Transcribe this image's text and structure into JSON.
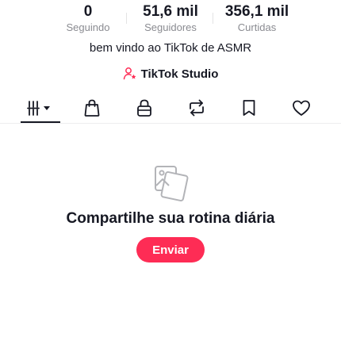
{
  "stats": {
    "following": {
      "value": "0",
      "label": "Seguindo"
    },
    "followers": {
      "value": "51,6 mil",
      "label": "Seguidores"
    },
    "likes": {
      "value": "356,1 mil",
      "label": "Curtidas"
    }
  },
  "bio": "bem vindo ao TikTok de ASMR",
  "studio": {
    "label": "TikTok Studio",
    "icon": "studio-person-star-icon",
    "accent": "#fe2c55"
  },
  "tabs": [
    {
      "icon": "videos-grid-icon",
      "selected": true
    },
    {
      "icon": "shopping-bag-icon",
      "selected": false
    },
    {
      "icon": "private-lock-icon",
      "selected": false
    },
    {
      "icon": "reposts-icon",
      "selected": false
    },
    {
      "icon": "favorites-bookmark-icon",
      "selected": false
    },
    {
      "icon": "liked-heart-icon",
      "selected": false
    }
  ],
  "empty_state": {
    "icon": "photos-icon",
    "title": "Compartilhe sua rotina diária",
    "button_label": "Enviar"
  },
  "colors": {
    "text": "#161823",
    "secondary_text": "#8a8b91",
    "brand_red": "#fe2c55"
  }
}
